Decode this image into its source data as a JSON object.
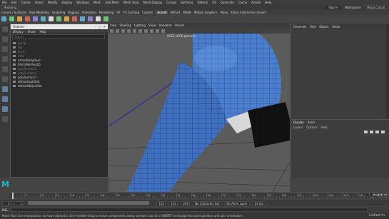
{
  "menubar": {
    "items": [
      "File",
      "Edit",
      "Create",
      "Select",
      "Modify",
      "Display",
      "Windows",
      "Mesh",
      "Edit Mesh",
      "Mesh Tools",
      "Mesh Display",
      "Curves",
      "Surfaces",
      "Deform",
      "UV",
      "Generate",
      "Cache",
      "Arnold",
      "Help"
    ],
    "workspace": "Workspace:",
    "workspace_value": "Maya Classic"
  },
  "statusline": {
    "mode": "Modeling",
    "signin": "Sign In"
  },
  "shelf": {
    "tabs": [
      "Curves / Surfaces",
      "Poly Modeling",
      "Sculpting",
      "Rigging",
      "Animation",
      "Rendering",
      "FX",
      "FX Caching",
      "Custom",
      "Arnold",
      "Bifrost",
      "MASH",
      "Motion Graphics",
      "XGen",
      "XGen_Interactive_Groom"
    ],
    "active_tab": "Arnold",
    "icon_colors": [
      "#5fa8c9",
      "#6fbf73",
      "#d9a441",
      "#c9655f",
      "#8c7fd1",
      "#5fa8c9",
      "#d9d9d9",
      "#6fbf73",
      "#d9a441",
      "#c9655f",
      "#5fa8c9",
      "#8c7fd1",
      "#d9d9d9",
      "#6fbf73"
    ]
  },
  "viewport": {
    "menu": [
      "View",
      "Shading",
      "Lighting",
      "Show",
      "Renderer",
      "Panels"
    ],
    "camera_label": "ACES sRGB gamma",
    "colors": {
      "mesh": "#3f6fbf",
      "wire": "#1e2a44",
      "background": "#5b5b5b",
      "curve": "#2a2aa0"
    }
  },
  "outliner": {
    "title": "Outliner",
    "menu": [
      "Display",
      "Show",
      "Help"
    ],
    "search_placeholder": "Search...",
    "items": [
      {
        "label": "persp",
        "dim": true
      },
      {
        "label": "top",
        "dim": true
      },
      {
        "label": "front",
        "dim": true
      },
      {
        "label": "side",
        "dim": true
      },
      {
        "label": "armorBodyBase",
        "dim": false
      },
      {
        "label": "ShirtsMeshes00",
        "dim": false
      },
      {
        "label": "polySurface1",
        "dim": true
      },
      {
        "label": "polySurface2",
        "dim": true
      },
      {
        "label": "polySurface7",
        "dim": false
      },
      {
        "label": "defaultLightSet",
        "dim": false
      },
      {
        "label": "defaultObjectSet",
        "dim": false
      }
    ]
  },
  "channel_box": {
    "menu": [
      "Channels",
      "Edit",
      "Object",
      "Show"
    ]
  },
  "layer_editor": {
    "tabs": [
      "Display",
      "Anim"
    ],
    "active_tab": "Display",
    "menu": [
      "Layers",
      "Options",
      "Help"
    ]
  },
  "timeline": {
    "current_frame": 1,
    "start": 1,
    "end": 120,
    "ticks": [
      "5",
      "10",
      "15",
      "20",
      "25",
      "30",
      "35",
      "40",
      "45",
      "50",
      "55",
      "60",
      "65",
      "70",
      "75",
      "80",
      "85",
      "90",
      "95",
      "100",
      "105",
      "110",
      "115",
      "120"
    ],
    "current_field": "1"
  },
  "range": {
    "start_field": "1",
    "start_inner": "1",
    "end_inner": "120",
    "end_field": "120",
    "end_max": "200",
    "character_set": "No Character Set",
    "anim_layer": "No Anim Layer",
    "fps": "24 fps"
  },
  "command_line": {
    "label": "MEL"
  },
  "help_line": {
    "text": "Move Tool: Use manipulator to move object(s). Ctrl+middle-drag to move components along normals. Use D or INSERT to change the pivot position and axis orientation."
  },
  "watermark": "Linked in"
}
